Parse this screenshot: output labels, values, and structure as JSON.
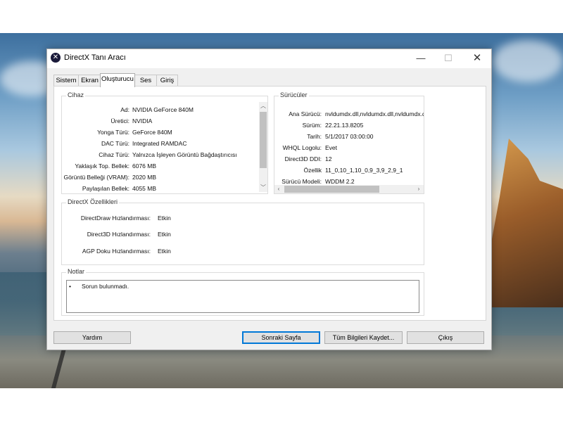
{
  "window": {
    "title": "DirectX Tanı Aracı"
  },
  "tabs": [
    {
      "label": "Sistem"
    },
    {
      "label": "Ekran"
    },
    {
      "label": "Oluşturucu"
    },
    {
      "label": "Ses"
    },
    {
      "label": "Giriş"
    }
  ],
  "device": {
    "title": "Cihaz",
    "rows": [
      {
        "label": "Ad:",
        "value": "NVIDIA GeForce 840M"
      },
      {
        "label": "Üretici:",
        "value": "NVIDIA"
      },
      {
        "label": "Yonga Türü:",
        "value": "GeForce 840M"
      },
      {
        "label": "DAC Türü:",
        "value": "Integrated RAMDAC"
      },
      {
        "label": "Cihaz Türü:",
        "value": "Yalnızca İşleyen Görüntü Bağdaştırıcısı"
      },
      {
        "label": "Yaklaşık Top. Bellek:",
        "value": "6076 MB"
      },
      {
        "label": "Görüntü Belleği (VRAM):",
        "value": "2020 MB"
      },
      {
        "label": "Paylaşılan Bellek:",
        "value": "4055 MB"
      }
    ]
  },
  "drivers": {
    "title": "Sürücüler",
    "rows": [
      {
        "label": "Ana Sürücü:",
        "value": "nvldumdx.dll,nvldumdx.dll,nvldumdx.d"
      },
      {
        "label": "Sürüm:",
        "value": "22.21.13.8205"
      },
      {
        "label": "Tarih:",
        "value": "5/1/2017 03:00:00"
      },
      {
        "label": "WHQL Logolu:",
        "value": "Evet"
      },
      {
        "label": "Direct3D DDI:",
        "value": "12"
      },
      {
        "label": "Özellik",
        "value": "11_0,10_1,10_0,9_3,9_2,9_1"
      },
      {
        "label": "Sürücü Modeli:",
        "value": "WDDM 2.2"
      }
    ]
  },
  "features": {
    "title": "DirectX Özellikleri",
    "rows": [
      {
        "label": "DirectDraw Hızlandırması:",
        "value": "Etkin"
      },
      {
        "label": "Direct3D Hızlandırması:",
        "value": "Etkin"
      },
      {
        "label": "AGP Doku Hızlandırması:",
        "value": "Etkin"
      }
    ]
  },
  "notes": {
    "title": "Notlar",
    "items": [
      {
        "bullet": "•",
        "text": "Sorun bulunmadı."
      }
    ]
  },
  "buttons": {
    "help": "Yardım",
    "next": "Sonraki Sayfa",
    "save": "Tüm Bilgileri Kaydet...",
    "exit": "Çıkış"
  },
  "icons": {
    "app": "directx-icon",
    "minimize": "minimize-icon",
    "maximize": "maximize-icon",
    "close": "close-icon"
  }
}
